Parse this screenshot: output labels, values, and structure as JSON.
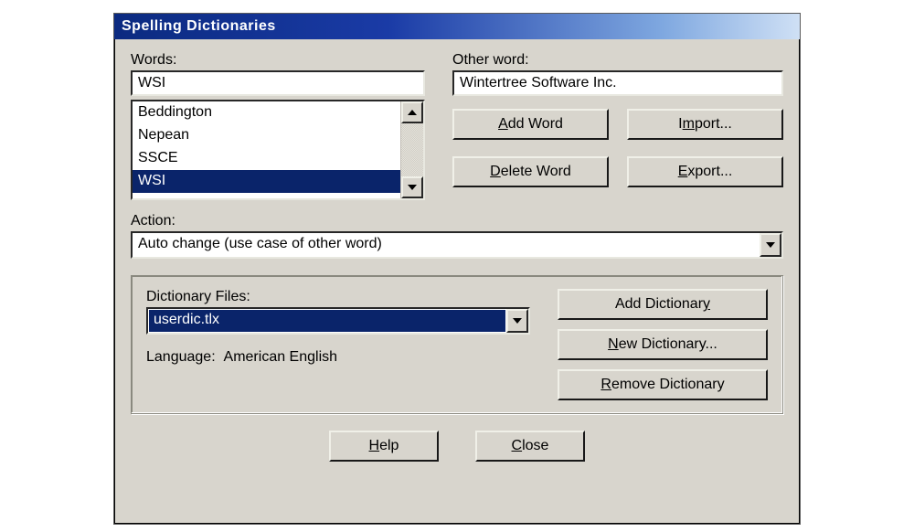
{
  "title": "Spelling Dictionaries",
  "words": {
    "label": "Words:",
    "value": "WSI",
    "items": [
      "Beddington",
      "Nepean",
      "SSCE",
      "WSI"
    ],
    "selected_index": 3
  },
  "other_word": {
    "label": "Other word:",
    "value": "Wintertree Software Inc."
  },
  "buttons": {
    "add_word_pre": "",
    "add_word_m": "A",
    "add_word_post": "dd Word",
    "import_pre": "I",
    "import_m": "m",
    "import_post": "port...",
    "delete_word_pre": "",
    "delete_word_m": "D",
    "delete_word_post": "elete Word",
    "export_pre": "",
    "export_m": "E",
    "export_post": "xport...",
    "add_dict_pre": "Add Dictionar",
    "add_dict_m": "y",
    "add_dict_post": "",
    "new_dict_pre": "",
    "new_dict_m": "N",
    "new_dict_post": "ew Dictionary...",
    "remove_dict_pre": "",
    "remove_dict_m": "R",
    "remove_dict_post": "emove Dictionary",
    "help_pre": "",
    "help_m": "H",
    "help_post": "elp",
    "close_pre": "",
    "close_m": "C",
    "close_post": "lose"
  },
  "action": {
    "label": "Action:",
    "value": "Auto change (use case of other word)"
  },
  "dictionary_files": {
    "label": "Dictionary Files:",
    "value": "userdic.tlx"
  },
  "language": {
    "label": "Language:",
    "value": "American English"
  }
}
